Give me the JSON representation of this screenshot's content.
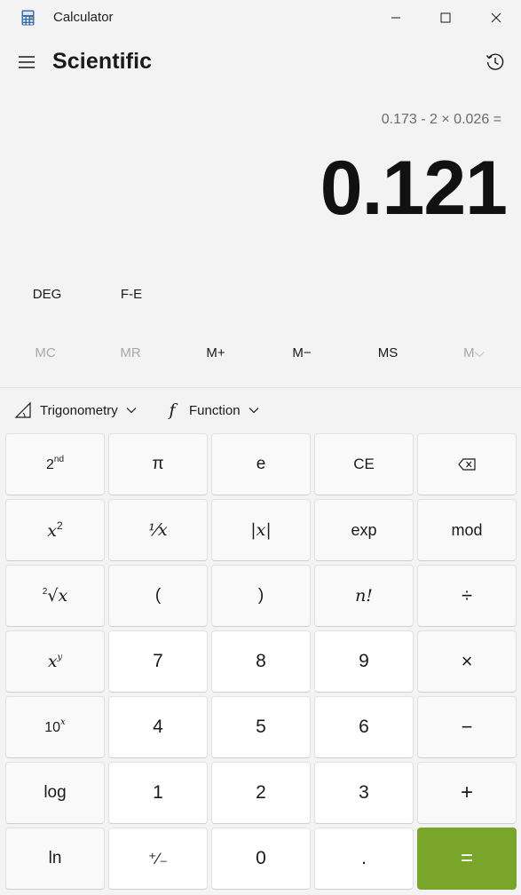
{
  "window": {
    "title": "Calculator"
  },
  "header": {
    "mode_title": "Scientific"
  },
  "display": {
    "expression": "0.173 - 2 × 0.026 =",
    "result": "0.121"
  },
  "modes": {
    "angle": "DEG",
    "fe": "F-E"
  },
  "memory": {
    "mc": "MC",
    "mr": "MR",
    "mplus": "M+",
    "mminus": "M−",
    "ms": "MS",
    "mlist": "M⌵"
  },
  "dropdowns": {
    "trigonometry": "Trigonometry",
    "function": "Function",
    "function_icon": "f"
  },
  "keys": {
    "second_base": "2",
    "second_sup": "nd",
    "pi": "π",
    "e": "e",
    "ce": "CE",
    "x_base": "x",
    "square_sup": "2",
    "reciprocal": "⅟x",
    "abs": "|x|",
    "exp": "exp",
    "mod": "mod",
    "root_index": "2",
    "root_body": "√x",
    "lparen": "(",
    "rparen": ")",
    "factorial": "n!",
    "divide": "÷",
    "pow_sup": "y",
    "seven": "7",
    "eight": "8",
    "nine": "9",
    "multiply": "×",
    "ten_base": "10",
    "ten_sup": "x",
    "four": "4",
    "five": "5",
    "six": "6",
    "minus": "−",
    "log": "log",
    "one": "1",
    "two": "2",
    "three": "3",
    "plus": "+",
    "ln": "ln",
    "negate": "⁺∕₋",
    "zero": "0",
    "decimal": ".",
    "equals": "="
  },
  "colors": {
    "accent": "#7aa52b",
    "background": "#f3f3f3"
  }
}
